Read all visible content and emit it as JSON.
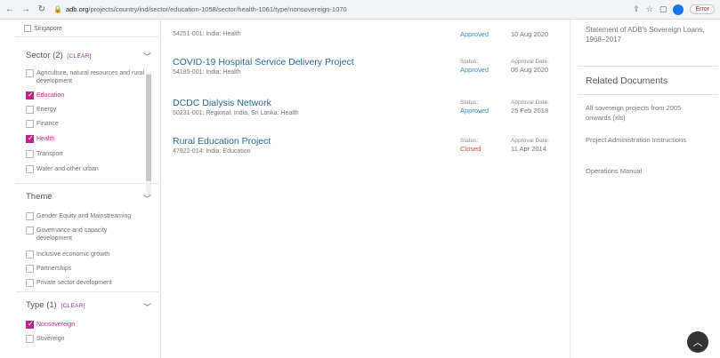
{
  "browser": {
    "url_prefix": "adb.org",
    "url_rest": "/projects/country/ind/sector/education-1058/sector/health-1061/type/nonsovereign-1070",
    "profile_error_label": "Error"
  },
  "sidebar": {
    "top_item": "Singapore",
    "sector": {
      "title": "Sector (2)",
      "clear": "[CLEAR]",
      "options": [
        {
          "label": "Agriculture, natural resources and rural development",
          "checked": false
        },
        {
          "label": "Education",
          "checked": true
        },
        {
          "label": "Energy",
          "checked": false
        },
        {
          "label": "Finance",
          "checked": false
        },
        {
          "label": "Health",
          "checked": true
        },
        {
          "label": "Transport",
          "checked": false
        },
        {
          "label": "Water and other urban",
          "checked": false
        }
      ]
    },
    "theme": {
      "title": "Theme",
      "options": [
        {
          "label": "Gender Equity and Mainstreaming",
          "checked": false
        },
        {
          "label": "Governance and capacity development",
          "checked": false
        },
        {
          "label": "Inclusive economic growth",
          "checked": false
        },
        {
          "label": "Partnerships",
          "checked": false
        },
        {
          "label": "Private sector development",
          "checked": false
        }
      ]
    },
    "type": {
      "title": "Type (1)",
      "clear": "[CLEAR]",
      "options": [
        {
          "label": "Nonsovereign",
          "checked": true
        },
        {
          "label": "Sovereign",
          "checked": false
        }
      ]
    }
  },
  "projects": [
    {
      "title": "",
      "subtitle": "54251-001: India: Health",
      "status_label": "",
      "status": "Approved",
      "date_label": "",
      "date": "10 Aug 2020"
    },
    {
      "title": "COVID-19 Hospital Service Delivery Project",
      "subtitle": "54185-001: India: Health",
      "status_label": "Status:",
      "status": "Approved",
      "date_label": "Approval Date:",
      "date": "06 Aug 2020"
    },
    {
      "title": "DCDC Dialysis Network",
      "subtitle": "50231-001: Regional: India, Sri Lanka: Health",
      "status_label": "Status:",
      "status": "Approved",
      "date_label": "Approval Date:",
      "date": "25 Feb 2018"
    },
    {
      "title": "Rural Education Project",
      "subtitle": "47922-014: India: Education",
      "status_label": "Status:",
      "status": "Closed",
      "date_label": "Approval Date:",
      "date": "11 Apr 2014"
    }
  ],
  "right_column": {
    "statement": "Statement of ADB's Sovereign Loans, 1968–2017",
    "related_heading": "Related Documents",
    "links": [
      "All sovereign projects from 2005 onwards (xls)",
      "Project Administration Instructions",
      "Operations Manual"
    ]
  }
}
